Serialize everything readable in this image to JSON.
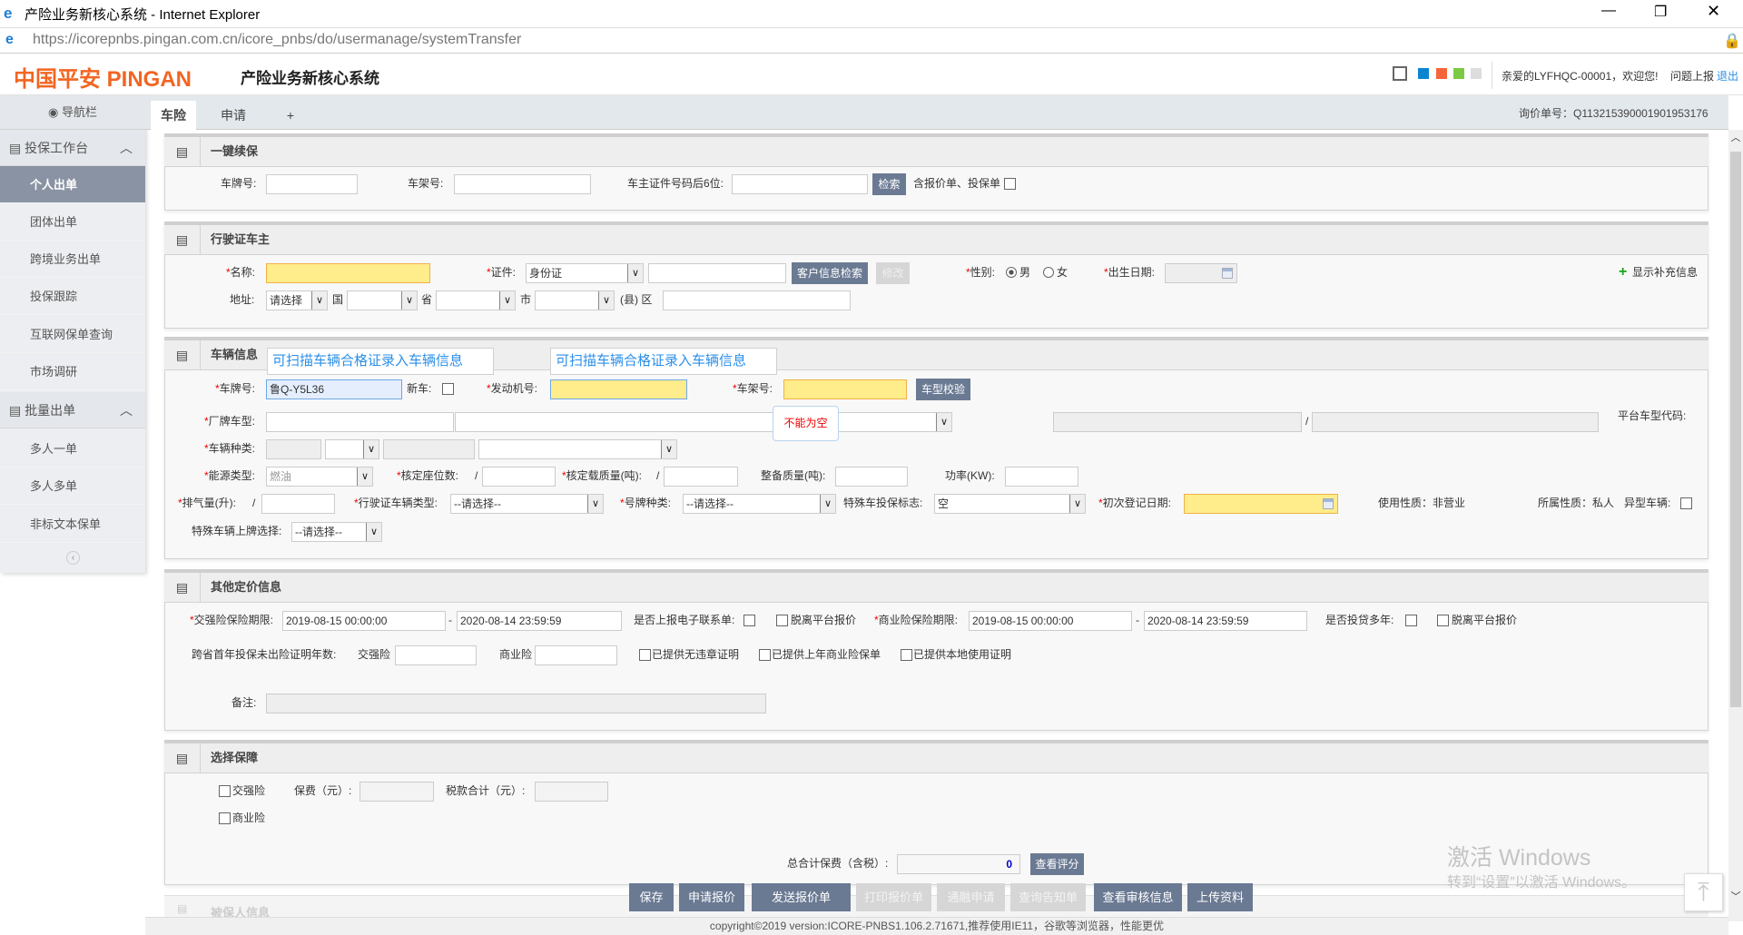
{
  "window": {
    "title": "产险业务新核心系统 - Internet Explorer",
    "url": "https://icorepnbs.pingan.com.cn/icore_pnbs/do/usermanage/systemTransfer"
  },
  "header": {
    "logo": "中国平安 PINGAN",
    "system_name": "产险业务新核心系统",
    "greeting": "亲爱的LYFHQC-00001，欢迎您!",
    "report": "问题上报",
    "logout": "退出",
    "theme_colors": [
      "#0a86d1",
      "#f5653a",
      "#7cc943",
      "#dddddd"
    ]
  },
  "sidebar": {
    "title": "导航栏",
    "groups": [
      {
        "label": "投保工作台",
        "items": [
          "个人出单",
          "团体出单",
          "跨境业务出单",
          "投保跟踪",
          "互联网保单查询",
          "市场调研"
        ]
      },
      {
        "label": "批量出单",
        "items": [
          "多人一单",
          "多人多单",
          "非标文本保单"
        ]
      }
    ],
    "active": "个人出单"
  },
  "tabs": [
    "车险",
    "申请",
    "+"
  ],
  "inquiry": "询价单号：Q113215390001901953176",
  "renew": {
    "title": "一键续保",
    "plate": "车牌号:",
    "vin": "车架号:",
    "idlast6": "车主证件号码后6位:",
    "search": "检索",
    "include": "含报价单、投保单"
  },
  "owner": {
    "title": "行驶证车主",
    "name": "名称:",
    "cert": "证件:",
    "cert_type": "身份证",
    "lookup": "客户信息检索",
    "modify": "修改",
    "gender": "性别:",
    "male": "男",
    "female": "女",
    "birth": "出生日期:",
    "more": "显示补充信息",
    "addr": "地址:",
    "addr_sel": "请选择",
    "country": "国",
    "province": "省",
    "city": "市",
    "county": "(县) 区"
  },
  "vehicle": {
    "title": "车辆信息",
    "tip": "可扫描车辆合格证录入车辆信息",
    "plate": "车牌号:",
    "plate_val": "鲁Q-Y5L36",
    "new": "新车:",
    "engine": "发动机号:",
    "vin": "车架号:",
    "check": "车型校验",
    "error": "不能为空",
    "brand": "厂牌车型:",
    "platform_code": "平台车型代码:",
    "kind": "车辆种类:",
    "energy": "能源类型:",
    "energy_val": "燃油",
    "seats": "核定座位数:",
    "load": "核定载质量(吨):",
    "curb": "整备质量(吨):",
    "power": "功率(KW):",
    "disp": "排气量(升):",
    "slash": "/",
    "lic_type": "行驶证车辆类型:",
    "plate_kind": "号牌种类:",
    "please": "--请选择--",
    "special": "特殊车投保标志:",
    "special_val": "空",
    "first_reg": "初次登记日期:",
    "use": "使用性质：非营业",
    "own": "所属性质：私人",
    "odd": "异型车辆:",
    "special_plate": "特殊车辆上牌选择:"
  },
  "pricing": {
    "title": "其他定价信息",
    "ci_period": "交强险保险期限:",
    "ci_start": "2019-08-15 00:00:00",
    "ci_end": "2020-08-14 23:59:59",
    "dash": "-",
    "e_report": "是否上报电子联系单:",
    "offplat": "脱离平台报价",
    "bi_period": "商业险保险期限:",
    "bi_start": "2019-08-15 00:00:00",
    "bi_end": "2020-08-14 23:59:59",
    "multi": "是否投贷多年:",
    "cross": "跨省首年投保未出险证明年数:",
    "ci": "交强险",
    "bi": "商业险",
    "c1": "已提供无违章证明",
    "c2": "已提供上年商业险保单",
    "c3": "已提供本地使用证明",
    "remark": "备注:"
  },
  "coverage": {
    "title": "选择保障",
    "ci": "交强险",
    "premium": "保费（元）:",
    "tax": "税款合计（元）:",
    "bi": "商业险",
    "total": "总合计保费（含税）:",
    "total_val": "0",
    "score": "查看评分"
  },
  "insured": {
    "title": "被保人信息"
  },
  "actions": [
    {
      "label": "保存",
      "enabled": true
    },
    {
      "label": "申请报价",
      "enabled": true
    },
    {
      "label": "发送报价单",
      "enabled": true
    },
    {
      "label": "打印报价单",
      "enabled": false
    },
    {
      "label": "通融申请",
      "enabled": false
    },
    {
      "label": "查询告知单",
      "enabled": false
    },
    {
      "label": "查看审核信息",
      "enabled": true
    },
    {
      "label": "上传资料",
      "enabled": true
    }
  ],
  "footer": "copyright©2019 version:ICORE-PNBS1.106.2.71671,推荐使用IE11，谷歌等浏览器，性能更优",
  "watermark": {
    "l1": "激活 Windows",
    "l2": "转到“设置”以激活 Windows。"
  }
}
